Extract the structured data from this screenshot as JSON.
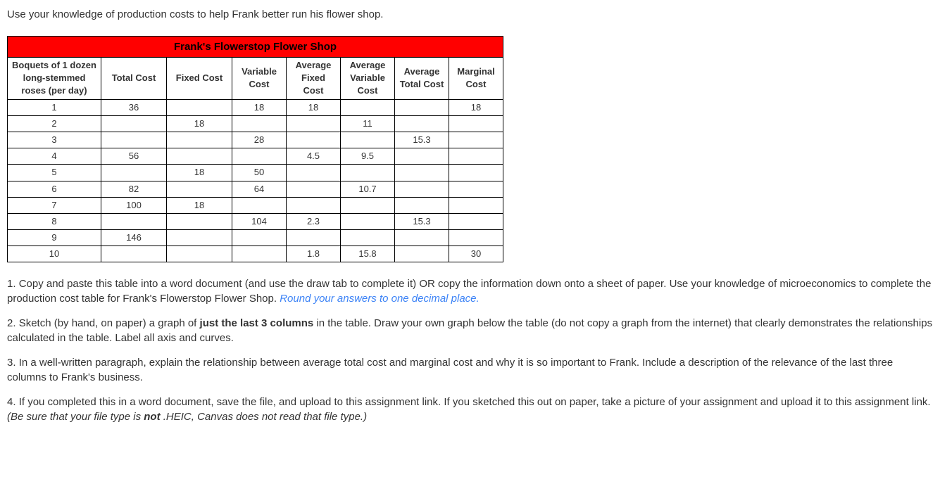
{
  "intro": "Use your knowledge of production costs to help Frank better run his flower shop.",
  "table": {
    "title": "Frank's Flowerstop Flower Shop",
    "headers": {
      "qty": "Boquets of 1 dozen long-stemmed roses (per day)",
      "tc": "Total Cost",
      "fc": "Fixed Cost",
      "vc": "Variable Cost",
      "afc": "Average Fixed Cost",
      "avc": "Average Variable Cost",
      "atc": "Average Total Cost",
      "mc": "Marginal Cost"
    },
    "rows": [
      {
        "qty": "1",
        "tc": "36",
        "fc": "",
        "vc": "18",
        "afc": "18",
        "avc": "",
        "atc": "",
        "mc": "18"
      },
      {
        "qty": "2",
        "tc": "",
        "fc": "18",
        "vc": "",
        "afc": "",
        "avc": "11",
        "atc": "",
        "mc": ""
      },
      {
        "qty": "3",
        "tc": "",
        "fc": "",
        "vc": "28",
        "afc": "",
        "avc": "",
        "atc": "15.3",
        "mc": ""
      },
      {
        "qty": "4",
        "tc": "56",
        "fc": "",
        "vc": "",
        "afc": "4.5",
        "avc": "9.5",
        "atc": "",
        "mc": ""
      },
      {
        "qty": "5",
        "tc": "",
        "fc": "18",
        "vc": "50",
        "afc": "",
        "avc": "",
        "atc": "",
        "mc": ""
      },
      {
        "qty": "6",
        "tc": "82",
        "fc": "",
        "vc": "64",
        "afc": "",
        "avc": "10.7",
        "atc": "",
        "mc": ""
      },
      {
        "qty": "7",
        "tc": "100",
        "fc": "18",
        "vc": "",
        "afc": "",
        "avc": "",
        "atc": "",
        "mc": ""
      },
      {
        "qty": "8",
        "tc": "",
        "fc": "",
        "vc": "104",
        "afc": "2.3",
        "avc": "",
        "atc": "15.3",
        "mc": ""
      },
      {
        "qty": "9",
        "tc": "146",
        "fc": "",
        "vc": "",
        "afc": "",
        "avc": "",
        "atc": "",
        "mc": ""
      },
      {
        "qty": "10",
        "tc": "",
        "fc": "",
        "vc": "",
        "afc": "1.8",
        "avc": "15.8",
        "atc": "",
        "mc": "30"
      }
    ]
  },
  "q1": {
    "num": "1.  ",
    "text_a": "Copy and paste this table into a word document (and use the draw tab to complete it) OR copy the information down onto a sheet of paper.  Use your knowledge of microeconomics to complete the production cost table for Frank's Flowerstop Flower Shop. ",
    "hint": "Round your answers to one decimal place."
  },
  "q2": {
    "num": "2.  ",
    "text_a": "Sketch (by hand, on paper) a graph of ",
    "bold": "just the last 3 columns",
    "text_b": " in the table.  Draw your own graph below the table (do not copy a graph from the internet) that clearly demonstrates the relationships calculated in the table.  Label all axis and curves."
  },
  "q3": {
    "num": "3.  ",
    "text": "In a well-written paragraph, explain the relationship between average total cost and marginal cost and why it is so important to Frank.  Include a description of the relevance of the last three columns to Frank's business."
  },
  "q4": {
    "num": "4.  ",
    "text_a": "If you completed this in a word document, save the file, and upload to this assignment link.  If you sketched this out on paper, take a picture of your assignment and upload it to this assignment link. ",
    "italic_a": "(Be sure that your file type is ",
    "bold": "not",
    "italic_b": " .HEIC, Canvas does not read that file type.)"
  }
}
